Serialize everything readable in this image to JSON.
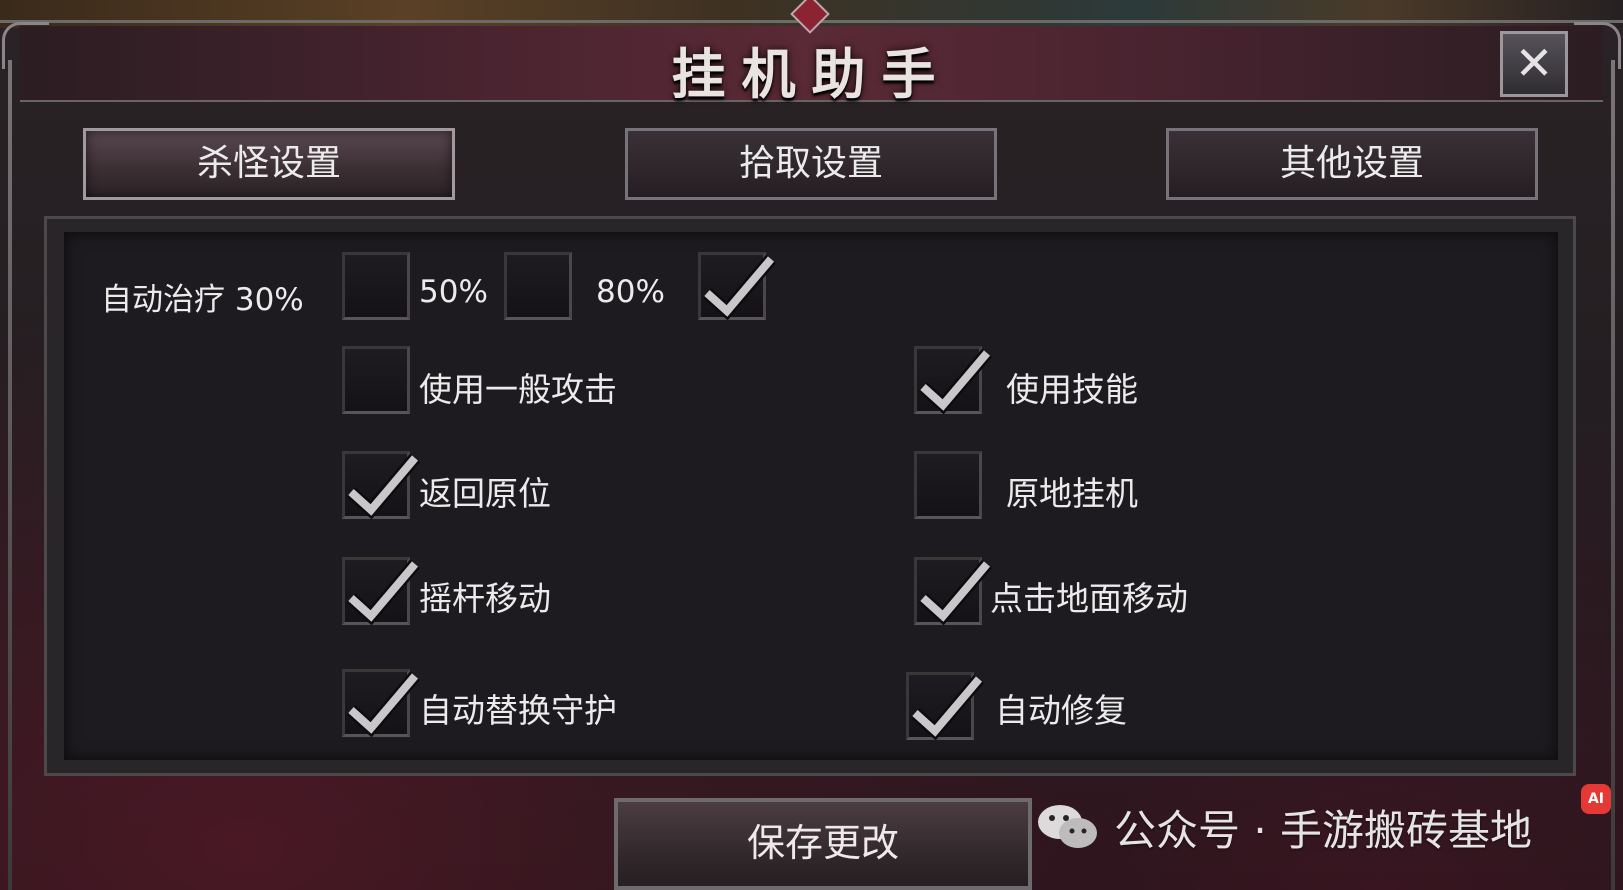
{
  "window": {
    "title": "挂机助手",
    "close_glyph": "✕"
  },
  "tabs": [
    {
      "label": "杀怪设置",
      "active": true
    },
    {
      "label": "拾取设置",
      "active": false
    },
    {
      "label": "其他设置",
      "active": false
    }
  ],
  "auto_heal": {
    "label": "自动治疗 30%",
    "opt_30_checked": false,
    "label_50": "50%",
    "opt_50_checked": false,
    "label_80": "80%",
    "opt_80_checked": true
  },
  "options": [
    {
      "label": "使用一般攻击",
      "checked": false
    },
    {
      "label": "使用技能",
      "checked": true
    },
    {
      "label": "返回原位",
      "checked": true
    },
    {
      "label": "原地挂机",
      "checked": false
    },
    {
      "label": "摇杆移动",
      "checked": true
    },
    {
      "label": "点击地面移动",
      "checked": true
    },
    {
      "label": "自动替换守护",
      "checked": true
    },
    {
      "label": "自动修复",
      "checked": true
    }
  ],
  "save_button": {
    "label": "保存更改"
  },
  "watermark": {
    "text": "公众号 · 手游搬砖基地",
    "icon": "wechat-icon"
  },
  "ai_badge": {
    "text": "AI"
  },
  "colors": {
    "accent": "#8b2333",
    "text": "#ecebeb",
    "panel": "#1d1b1f"
  }
}
